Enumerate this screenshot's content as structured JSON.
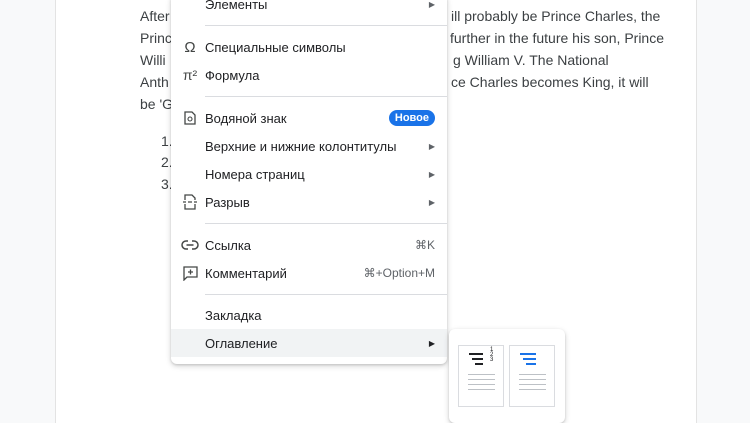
{
  "document": {
    "lines": [
      "After",
      "Princ",
      "Willi",
      "Anth",
      "be 'G"
    ],
    "right_lines": [
      "ill probably be Prince Charles, the",
      "further in the future his son, Prince",
      "g William V. The National",
      "ce Charles becomes King, it will"
    ],
    "list_numbers": [
      "1.",
      "2.",
      "3."
    ]
  },
  "menu": {
    "elements": "Элементы",
    "special_chars": "Специальные символы",
    "formula": "Формула",
    "watermark": "Водяной знак",
    "watermark_badge": "Новое",
    "headers_footers": "Верхние и нижние колонтитулы",
    "page_numbers": "Номера страниц",
    "break": "Разрыв",
    "link": "Ссылка",
    "link_shortcut": "⌘K",
    "comment": "Комментарий",
    "comment_shortcut": "⌘+Option+M",
    "bookmark": "Закладка",
    "toc": "Оглавление",
    "formula_glyph": "π²",
    "special_glyph": "Ω",
    "submenu_arrow": "▶"
  },
  "colors": {
    "accent": "#1a73e8",
    "text": "#202124",
    "muted": "#5f6368"
  }
}
